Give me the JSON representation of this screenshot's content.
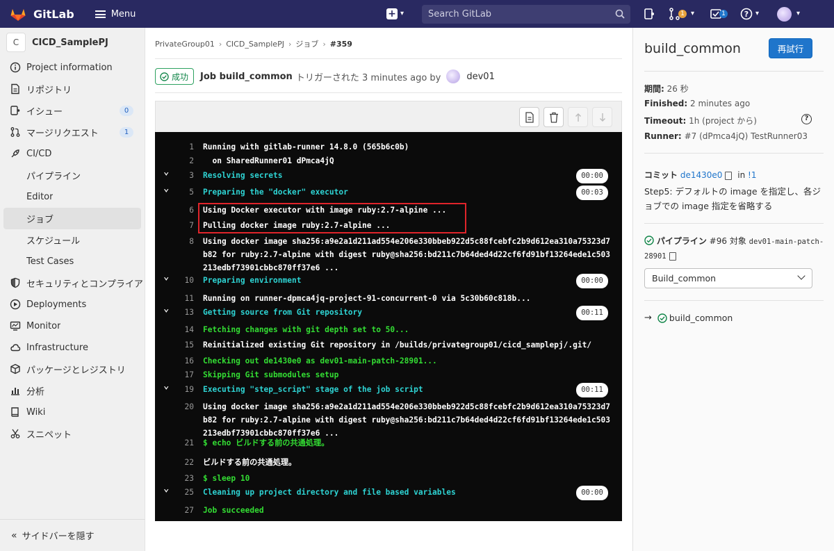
{
  "topbar": {
    "brand": "GitLab",
    "menu_label": "Menu",
    "search_placeholder": "Search GitLab",
    "merge_requests_count": "1",
    "todos_count": "1",
    "colors": {
      "bg": "#292961",
      "mr_badge": "#e8a33d",
      "todo_badge": "#1f75cb"
    }
  },
  "sidebar": {
    "project_initial": "C",
    "project_name": "CICD_SamplePJ",
    "items": [
      {
        "label": "Project information",
        "icon": "info-icon"
      },
      {
        "label": "リポジトリ",
        "icon": "file-icon"
      },
      {
        "label": "イシュー",
        "icon": "issues-icon",
        "count": "0"
      },
      {
        "label": "マージリクエスト",
        "icon": "merge-request-icon",
        "count": "1"
      },
      {
        "label": "CI/CD",
        "icon": "rocket-icon"
      },
      {
        "label": "パイプライン",
        "sub": true
      },
      {
        "label": "Editor",
        "sub": true
      },
      {
        "label": "ジョブ",
        "sub": true,
        "active": true
      },
      {
        "label": "スケジュール",
        "sub": true
      },
      {
        "label": "Test Cases",
        "sub": true
      },
      {
        "label": "セキュリティとコンプライアンス",
        "icon": "shield-icon"
      },
      {
        "label": "Deployments",
        "icon": "deployments-icon"
      },
      {
        "label": "Monitor",
        "icon": "monitor-icon"
      },
      {
        "label": "Infrastructure",
        "icon": "cloud-icon"
      },
      {
        "label": "パッケージとレジストリ",
        "icon": "package-icon"
      },
      {
        "label": "分析",
        "icon": "chart-icon"
      },
      {
        "label": "Wiki",
        "icon": "book-icon"
      },
      {
        "label": "スニペット",
        "icon": "snippet-icon"
      }
    ],
    "collapse_label": "サイドバーを隠す"
  },
  "breadcrumb": [
    "PrivateGroup01",
    "CICD_SamplePJ",
    "ジョブ",
    "#359"
  ],
  "job_header": {
    "status": "成功",
    "title": "Job build_common",
    "triggered": "トリガーされた 3 minutes ago by",
    "user": "dev01"
  },
  "log": [
    {
      "n": "1",
      "text": "Running with gitlab-runner 14.8.0 (565b6c0b)",
      "color": "white"
    },
    {
      "n": "2",
      "text": "  on SharedRunner01 dPmca4jQ",
      "color": "white"
    },
    {
      "n": "3",
      "text": "Resolving secrets",
      "color": "cyan",
      "section": true,
      "duration": "00:00"
    },
    {
      "n": "5",
      "text": "Preparing the \"docker\" executor",
      "color": "cyan",
      "section": true,
      "duration": "00:03"
    },
    {
      "n": "6",
      "text": "Using Docker executor with image ruby:2.7-alpine ...",
      "color": "white"
    },
    {
      "n": "7",
      "text": "Pulling docker image ruby:2.7-alpine ...",
      "color": "white"
    },
    {
      "n": "8",
      "text": "Using docker image sha256:a9e2a1d211ad554e206e330bbeb922d5c88fcebfc2b9d612ea310a75323d7b82 for ruby:2.7-alpine with digest ruby@sha256:bd211c7b64ded4d22cf6fd91bf13264ede1c503213edbf73901cbbc870ff37e6 ...",
      "color": "white"
    },
    {
      "n": "10",
      "text": "Preparing environment",
      "color": "cyan",
      "section": true,
      "duration": "00:00"
    },
    {
      "n": "11",
      "text": "Running on runner-dpmca4jq-project-91-concurrent-0 via 5c30b60c818b...",
      "color": "white"
    },
    {
      "n": "13",
      "text": "Getting source from Git repository",
      "color": "cyan",
      "section": true,
      "duration": "00:11"
    },
    {
      "n": "14",
      "text": "Fetching changes with git depth set to 50...",
      "color": "green"
    },
    {
      "n": "15",
      "text": "Reinitialized existing Git repository in /builds/privategroup01/cicd_samplepj/.git/",
      "color": "white"
    },
    {
      "n": "16",
      "text": "Checking out de1430e0 as dev01-main-patch-28901...",
      "color": "green"
    },
    {
      "n": "17",
      "text": "Skipping Git submodules setup",
      "color": "green"
    },
    {
      "n": "19",
      "text": "Executing \"step_script\" stage of the job script",
      "color": "cyan",
      "section": true,
      "duration": "00:11"
    },
    {
      "n": "20",
      "text": "Using docker image sha256:a9e2a1d211ad554e206e330bbeb922d5c88fcebfc2b9d612ea310a75323d7b82 for ruby:2.7-alpine with digest ruby@sha256:bd211c7b64ded4d22cf6fd91bf13264ede1c503213edbf73901cbbc870ff37e6 ...",
      "color": "white"
    },
    {
      "n": "21",
      "text": "$ echo ビルドする前の共通処理。",
      "color": "green"
    },
    {
      "n": "22",
      "text": "ビルドする前の共通処理。",
      "color": "white"
    },
    {
      "n": "23",
      "text": "$ sleep 10",
      "color": "green"
    },
    {
      "n": "25",
      "text": "Cleaning up project directory and file based variables",
      "color": "cyan",
      "section": true,
      "duration": "00:00"
    },
    {
      "n": "27",
      "text": "Job succeeded",
      "color": "green"
    }
  ],
  "sidebar_right": {
    "title": "build_common",
    "retry_label": "再試行",
    "duration_label": "期間:",
    "duration_value": "26 秒",
    "finished_label": "Finished:",
    "finished_value": "2 minutes ago",
    "timeout_label": "Timeout:",
    "timeout_value": "1h (project から)",
    "runner_label": "Runner:",
    "runner_value": "#7 (dPmca4jQ) TestRunner03",
    "commit_label": "コミット",
    "commit_sha": "de1430e0",
    "commit_in": "in",
    "commit_mr": "!1",
    "commit_message": "Step5: デフォルトの image を指定し、各ジョブでの image 指定を省略する",
    "pipeline_label": "パイプライン",
    "pipeline_id": "#96",
    "pipeline_for": "対象",
    "pipeline_ref": "dev01-main-patch-28901",
    "stage_value": "Build_common",
    "job_name": "build_common"
  }
}
